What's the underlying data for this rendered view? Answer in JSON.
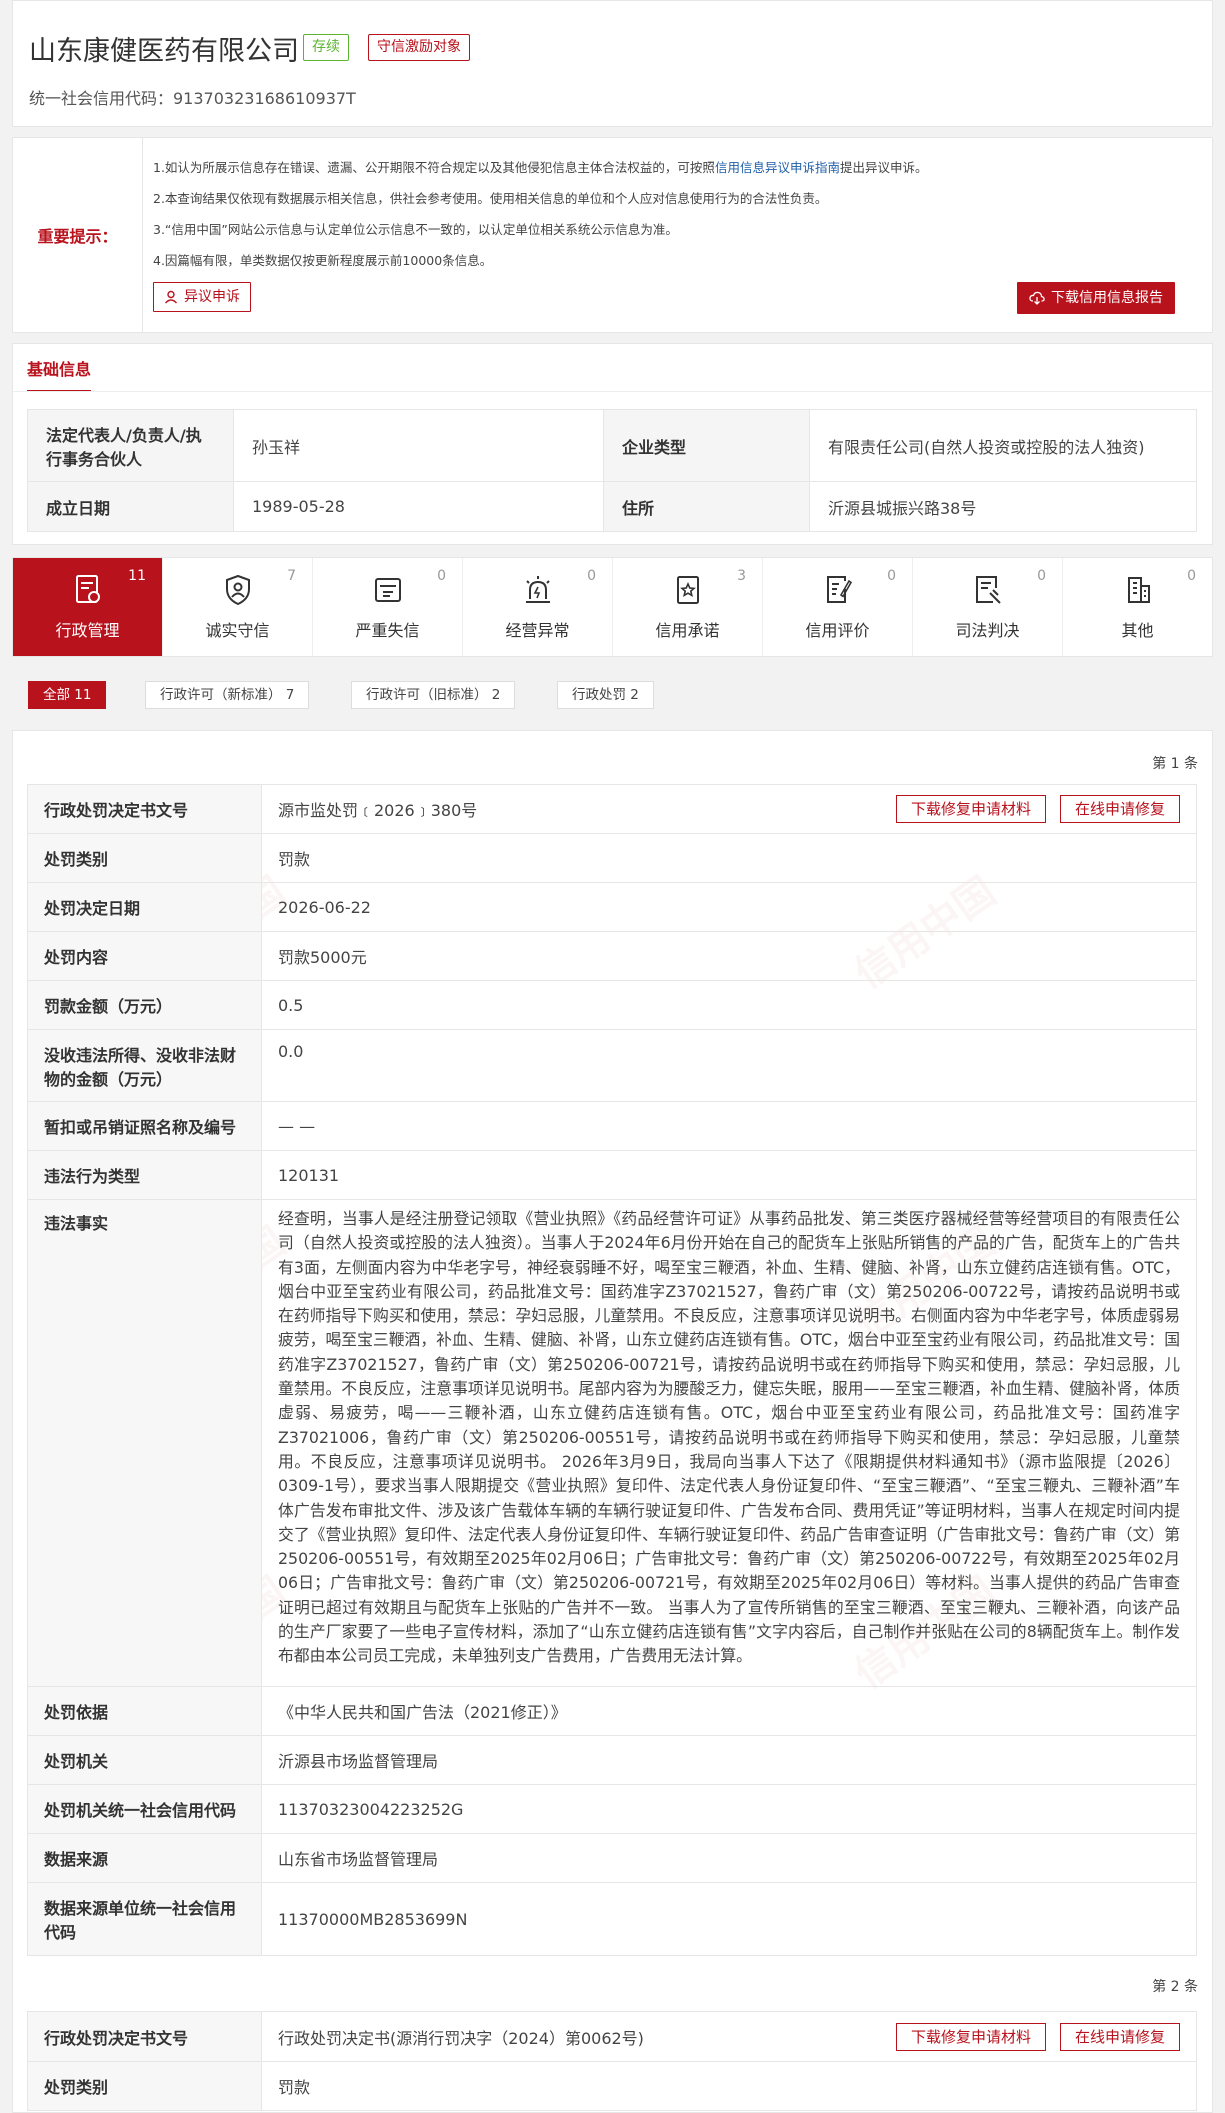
{
  "header": {
    "company_name": "山东康健医药有限公司",
    "status_badge": "存续",
    "honor_badge": "守信激励对象",
    "credit_code": "统一社会信用代码：91370323168610937T"
  },
  "notice": {
    "label": "重要提示：",
    "line1_pre": "1.如认为所展示信息存在错误、遗漏、公开期限不符合规定以及其他侵犯信息主体合法权益的，可按照",
    "line1_link": "信用信息异议申诉指南",
    "line1_post": "提出异议申诉。",
    "line2": "2.本查询结果仅依现有数据展示相关信息，供社会参考使用。使用相关信息的单位和个人应对信息使用行为的合法性负责。",
    "line3": "3.“信用中国”网站公示信息与认定单位公示信息不一致的，以认定单位相关系统公示信息为准。",
    "line4": "4.因篇幅有限，单类数据仅按更新程度展示前10000条信息。",
    "appeal_button": "异议申诉",
    "download_button": "下载信用信息报告"
  },
  "basic": {
    "title": "基础信息",
    "legal_rep_label": "法定代表人/负责人/执行事务合伙人",
    "legal_rep_value": "孙玉祥",
    "type_label": "企业类型",
    "type_value": "有限责任公司(自然人投资或控股的法人独资)",
    "date_label": "成立日期",
    "date_value": "1989-05-28",
    "address_label": "住所",
    "address_value": "沂源县城振兴路38号"
  },
  "tabs": [
    {
      "label": "行政管理",
      "count": "11",
      "icon": "document-seal-icon"
    },
    {
      "label": "诚实守信",
      "count": "7",
      "icon": "shield-user-icon"
    },
    {
      "label": "严重失信",
      "count": "0",
      "icon": "blacklist-card-icon"
    },
    {
      "label": "经营异常",
      "count": "0",
      "icon": "alarm-light-icon"
    },
    {
      "label": "信用承诺",
      "count": "3",
      "icon": "star-document-icon"
    },
    {
      "label": "信用评价",
      "count": "0",
      "icon": "edit-document-icon"
    },
    {
      "label": "司法判决",
      "count": "0",
      "icon": "gavel-document-icon"
    },
    {
      "label": "其他",
      "count": "0",
      "icon": "building-icon"
    }
  ],
  "filters": {
    "all": "全部  11",
    "license_new": "行政许可（新标准）  7",
    "license_old": "行政许可（旧标准）  2",
    "penalty": "行政处罚  2"
  },
  "watermark": "信用中国",
  "record1": {
    "no": "第 1 条",
    "btn_download": "下载修复申请材料",
    "btn_online": "在线申请修复",
    "rows": [
      {
        "label": "行政处罚决定书文号",
        "value": "源市监处罚﹝2026﹞380号"
      },
      {
        "label": "处罚类别",
        "value": "罚款"
      },
      {
        "label": "处罚决定日期",
        "value": "2026-06-22"
      },
      {
        "label": "处罚内容",
        "value": "罚款5000元"
      },
      {
        "label": "罚款金额（万元）",
        "value": "0.5"
      },
      {
        "label": "没收违法所得、没收非法财物的金额（万元）",
        "value": "0.0"
      },
      {
        "label": "暂扣或吊销证照名称及编号",
        "value": "— —"
      },
      {
        "label": "违法行为类型",
        "value": "120131"
      },
      {
        "label": "违法事实",
        "value": "经查明，当事人是经注册登记领取《营业执照》《药品经营许可证》从事药品批发、第三类医疗器械经营等经营项目的有限责任公司（自然人投资或控股的法人独资）。当事人于2024年6月份开始在自己的配货车上张贴所销售的产品的广告，配货车上的广告共有3面，左侧面内容为中华老字号，神经衰弱睡不好，喝至宝三鞭酒，补血、生精、健脑、补肾，山东立健药店连锁有售。OTC，烟台中亚至宝药业有限公司，药品批准文号：国药准字Z37021527，鲁药广审（文）第250206-00722号，请按药品说明书或在药师指导下购买和使用，禁忌：孕妇忌服，儿童禁用。不良反应，注意事项详见说明书。右侧面内容为中华老字号，体质虚弱易疲劳，喝至宝三鞭酒，补血、生精、健脑、补肾，山东立健药店连锁有售。OTC，烟台中亚至宝药业有限公司，药品批准文号：国药准字Z37021527，鲁药广审（文）第250206-00721号，请按药品说明书或在药师指导下购买和使用，禁忌：孕妇忌服，儿童禁用。不良反应，注意事项详见说明书。尾部内容为为腰酸乏力，健忘失眠，服用——至宝三鞭酒，补血生精、健脑补肾，体质虚弱、易疲劳，喝——三鞭补酒，山东立健药店连锁有售。OTC，烟台中亚至宝药业有限公司，药品批准文号：国药准字Z37021006，鲁药广审（文）第250206-00551号，请按药品说明书或在药师指导下购买和使用，禁忌：孕妇忌服，儿童禁用。不良反应，注意事项详见说明书。 2026年3月9日，我局向当事人下达了《限期提供材料通知书》（源市监限提〔2026〕0309-1号），要求当事人限期提交《营业执照》复印件、法定代表人身份证复印件、“至宝三鞭酒”、“至宝三鞭丸、三鞭补酒”车体广告发布审批文件、涉及该广告载体车辆的车辆行驶证复印件、广告发布合同、费用凭证”等证明材料，当事人在规定时间内提交了《营业执照》复印件、法定代表人身份证复印件、车辆行驶证复印件、药品广告审查证明（广告审批文号：鲁药广审（文）第250206-00551号，有效期至2025年02月06日；广告审批文号：鲁药广审（文）第250206-00722号，有效期至2025年02月06日；广告审批文号：鲁药广审（文）第250206-00721号，有效期至2025年02月06日）等材料。当事人提供的药品广告审查证明已超过有效期且与配货车上张贴的广告并不一致。 当事人为了宣传所销售的至宝三鞭酒、至宝三鞭丸、三鞭补酒，向该产品的生产厂家要了一些电子宣传材料，添加了“山东立健药店连锁有售”文字内容后，自己制作并张贴在公司的8辆配货车上。制作发布都由本公司员工完成，未单独列支广告费用，广告费用无法计算。"
      },
      {
        "label": "处罚依据",
        "value": "《中华人民共和国广告法（2021修正）》"
      },
      {
        "label": "处罚机关",
        "value": "沂源县市场监督管理局"
      },
      {
        "label": "处罚机关统一社会信用代码",
        "value": "11370323004223252G"
      },
      {
        "label": "数据来源",
        "value": "山东省市场监督管理局"
      },
      {
        "label": "数据来源单位统一社会信用代码",
        "value": "11370000MB2853699N"
      }
    ]
  },
  "record2": {
    "no": "第 2 条",
    "btn_download": "下载修复申请材料",
    "btn_online": "在线申请修复",
    "rows": [
      {
        "label": "行政处罚决定书文号",
        "value": "行政处罚决定书(源消行罚决字（2024）第0062号)"
      },
      {
        "label": "处罚类别",
        "value": "罚款"
      }
    ]
  }
}
